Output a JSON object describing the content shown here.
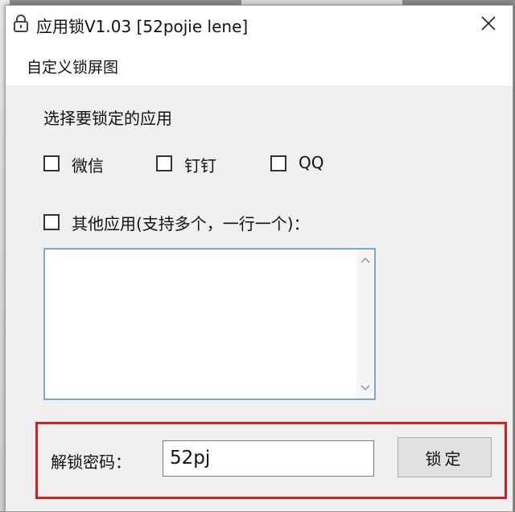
{
  "window": {
    "title": "应用锁V1.03 [52pojie lene]",
    "close_label": "×"
  },
  "menu": {
    "items": [
      {
        "label": "自定义锁屏图"
      }
    ]
  },
  "form": {
    "choose_label": "选择要锁定的应用",
    "apps": [
      {
        "label": "微信",
        "checked": false
      },
      {
        "label": "钉钉",
        "checked": false
      },
      {
        "label": "QQ",
        "checked": false
      }
    ],
    "other_apps_label": "其他应用(支持多个，一行一个)：",
    "other_apps_checked": false,
    "other_apps_value": ""
  },
  "unlock": {
    "label": "解锁密码：",
    "password_value": "52pj",
    "button_label": "锁定"
  },
  "colors": {
    "highlight_frame": "#d21f2c",
    "textarea_border": "#7aa6d8"
  }
}
